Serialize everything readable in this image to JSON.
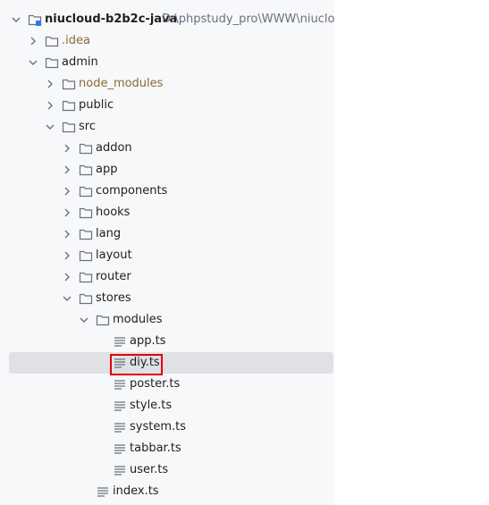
{
  "tree": {
    "root": {
      "name": "niucloud-b2b2c-java",
      "path": "D:\\phpstudy_pro\\WWW\\niucloud"
    },
    "items": [
      {
        "label": ".idea",
        "kind": "folder",
        "state": "collapsed",
        "style": "idea"
      },
      {
        "label": "admin",
        "kind": "folder",
        "state": "expanded"
      },
      {
        "label": "node_modules",
        "kind": "folder",
        "state": "collapsed",
        "style": "excluded"
      },
      {
        "label": "public",
        "kind": "folder",
        "state": "collapsed"
      },
      {
        "label": "src",
        "kind": "folder",
        "state": "expanded"
      },
      {
        "label": "addon",
        "kind": "folder",
        "state": "collapsed"
      },
      {
        "label": "app",
        "kind": "folder",
        "state": "collapsed"
      },
      {
        "label": "components",
        "kind": "folder",
        "state": "collapsed"
      },
      {
        "label": "hooks",
        "kind": "folder",
        "state": "collapsed"
      },
      {
        "label": "lang",
        "kind": "folder",
        "state": "collapsed"
      },
      {
        "label": "layout",
        "kind": "folder",
        "state": "collapsed"
      },
      {
        "label": "router",
        "kind": "folder",
        "state": "collapsed"
      },
      {
        "label": "stores",
        "kind": "folder",
        "state": "expanded"
      },
      {
        "label": "modules",
        "kind": "folder",
        "state": "expanded"
      },
      {
        "label": "app.ts",
        "kind": "file"
      },
      {
        "label": "diy.ts",
        "kind": "file",
        "selected": true
      },
      {
        "label": "poster.ts",
        "kind": "file"
      },
      {
        "label": "style.ts",
        "kind": "file"
      },
      {
        "label": "system.ts",
        "kind": "file"
      },
      {
        "label": "tabbar.ts",
        "kind": "file"
      },
      {
        "label": "user.ts",
        "kind": "file"
      },
      {
        "label": "index.ts",
        "kind": "file"
      }
    ]
  },
  "colors": {
    "selection": "#dfe1e5",
    "highlight_border": "#e00000",
    "excluded_text": "#8a6a34",
    "path_text": "#6c707e"
  }
}
